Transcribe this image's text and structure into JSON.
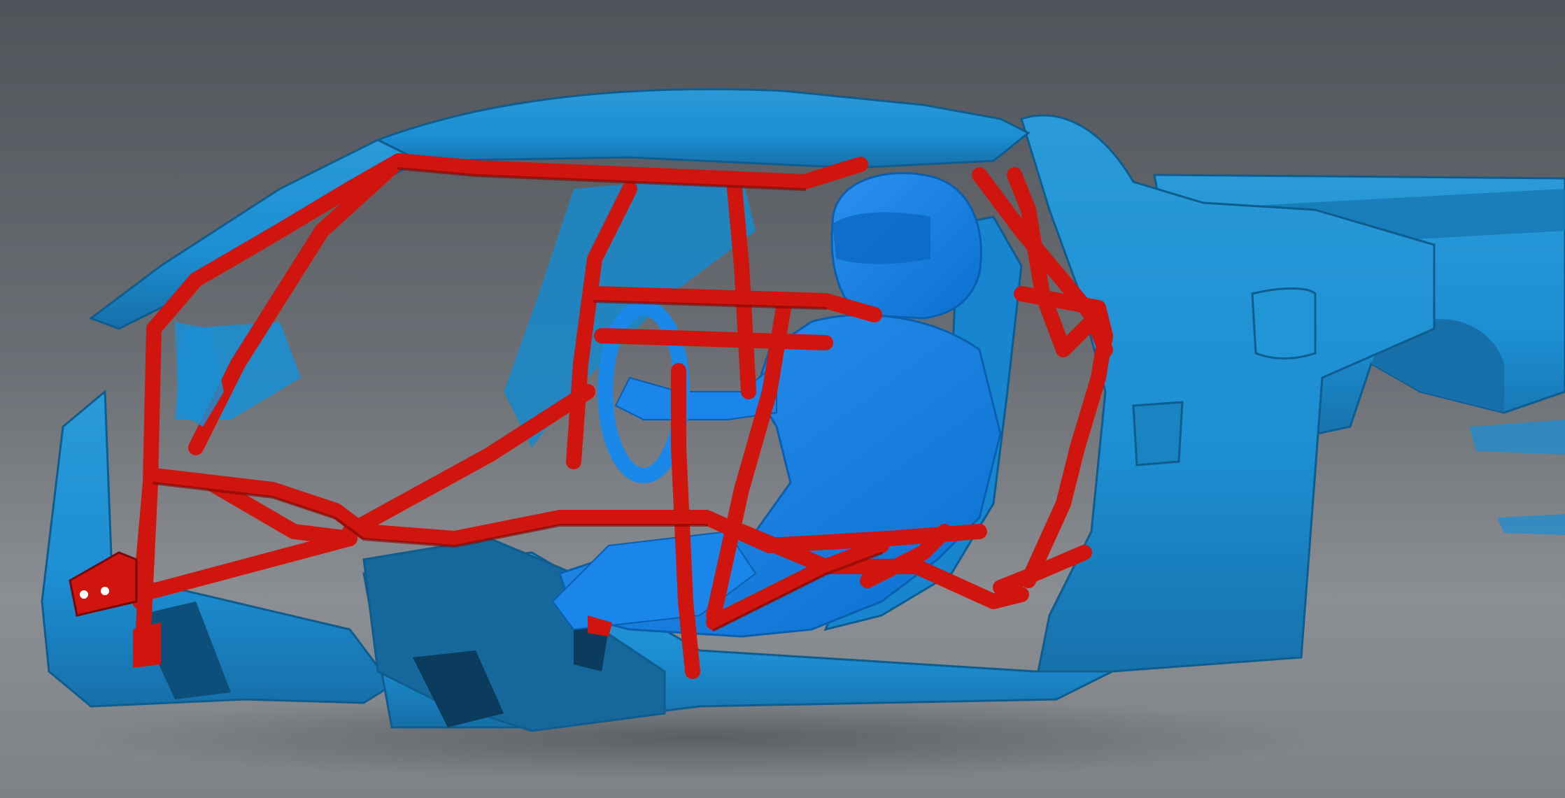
{
  "viewport": {
    "background_top": "#505459",
    "background_bottom": "#8b8e92"
  },
  "scene": {
    "scan_color": "#1c8ed2",
    "scan_dark": "#0f5d8f",
    "scan_light": "#3aa8e6",
    "driver_color": "#0d7fe8",
    "roll_cage_color": "#d0150f",
    "roll_cage_dark": "#7a0705"
  }
}
